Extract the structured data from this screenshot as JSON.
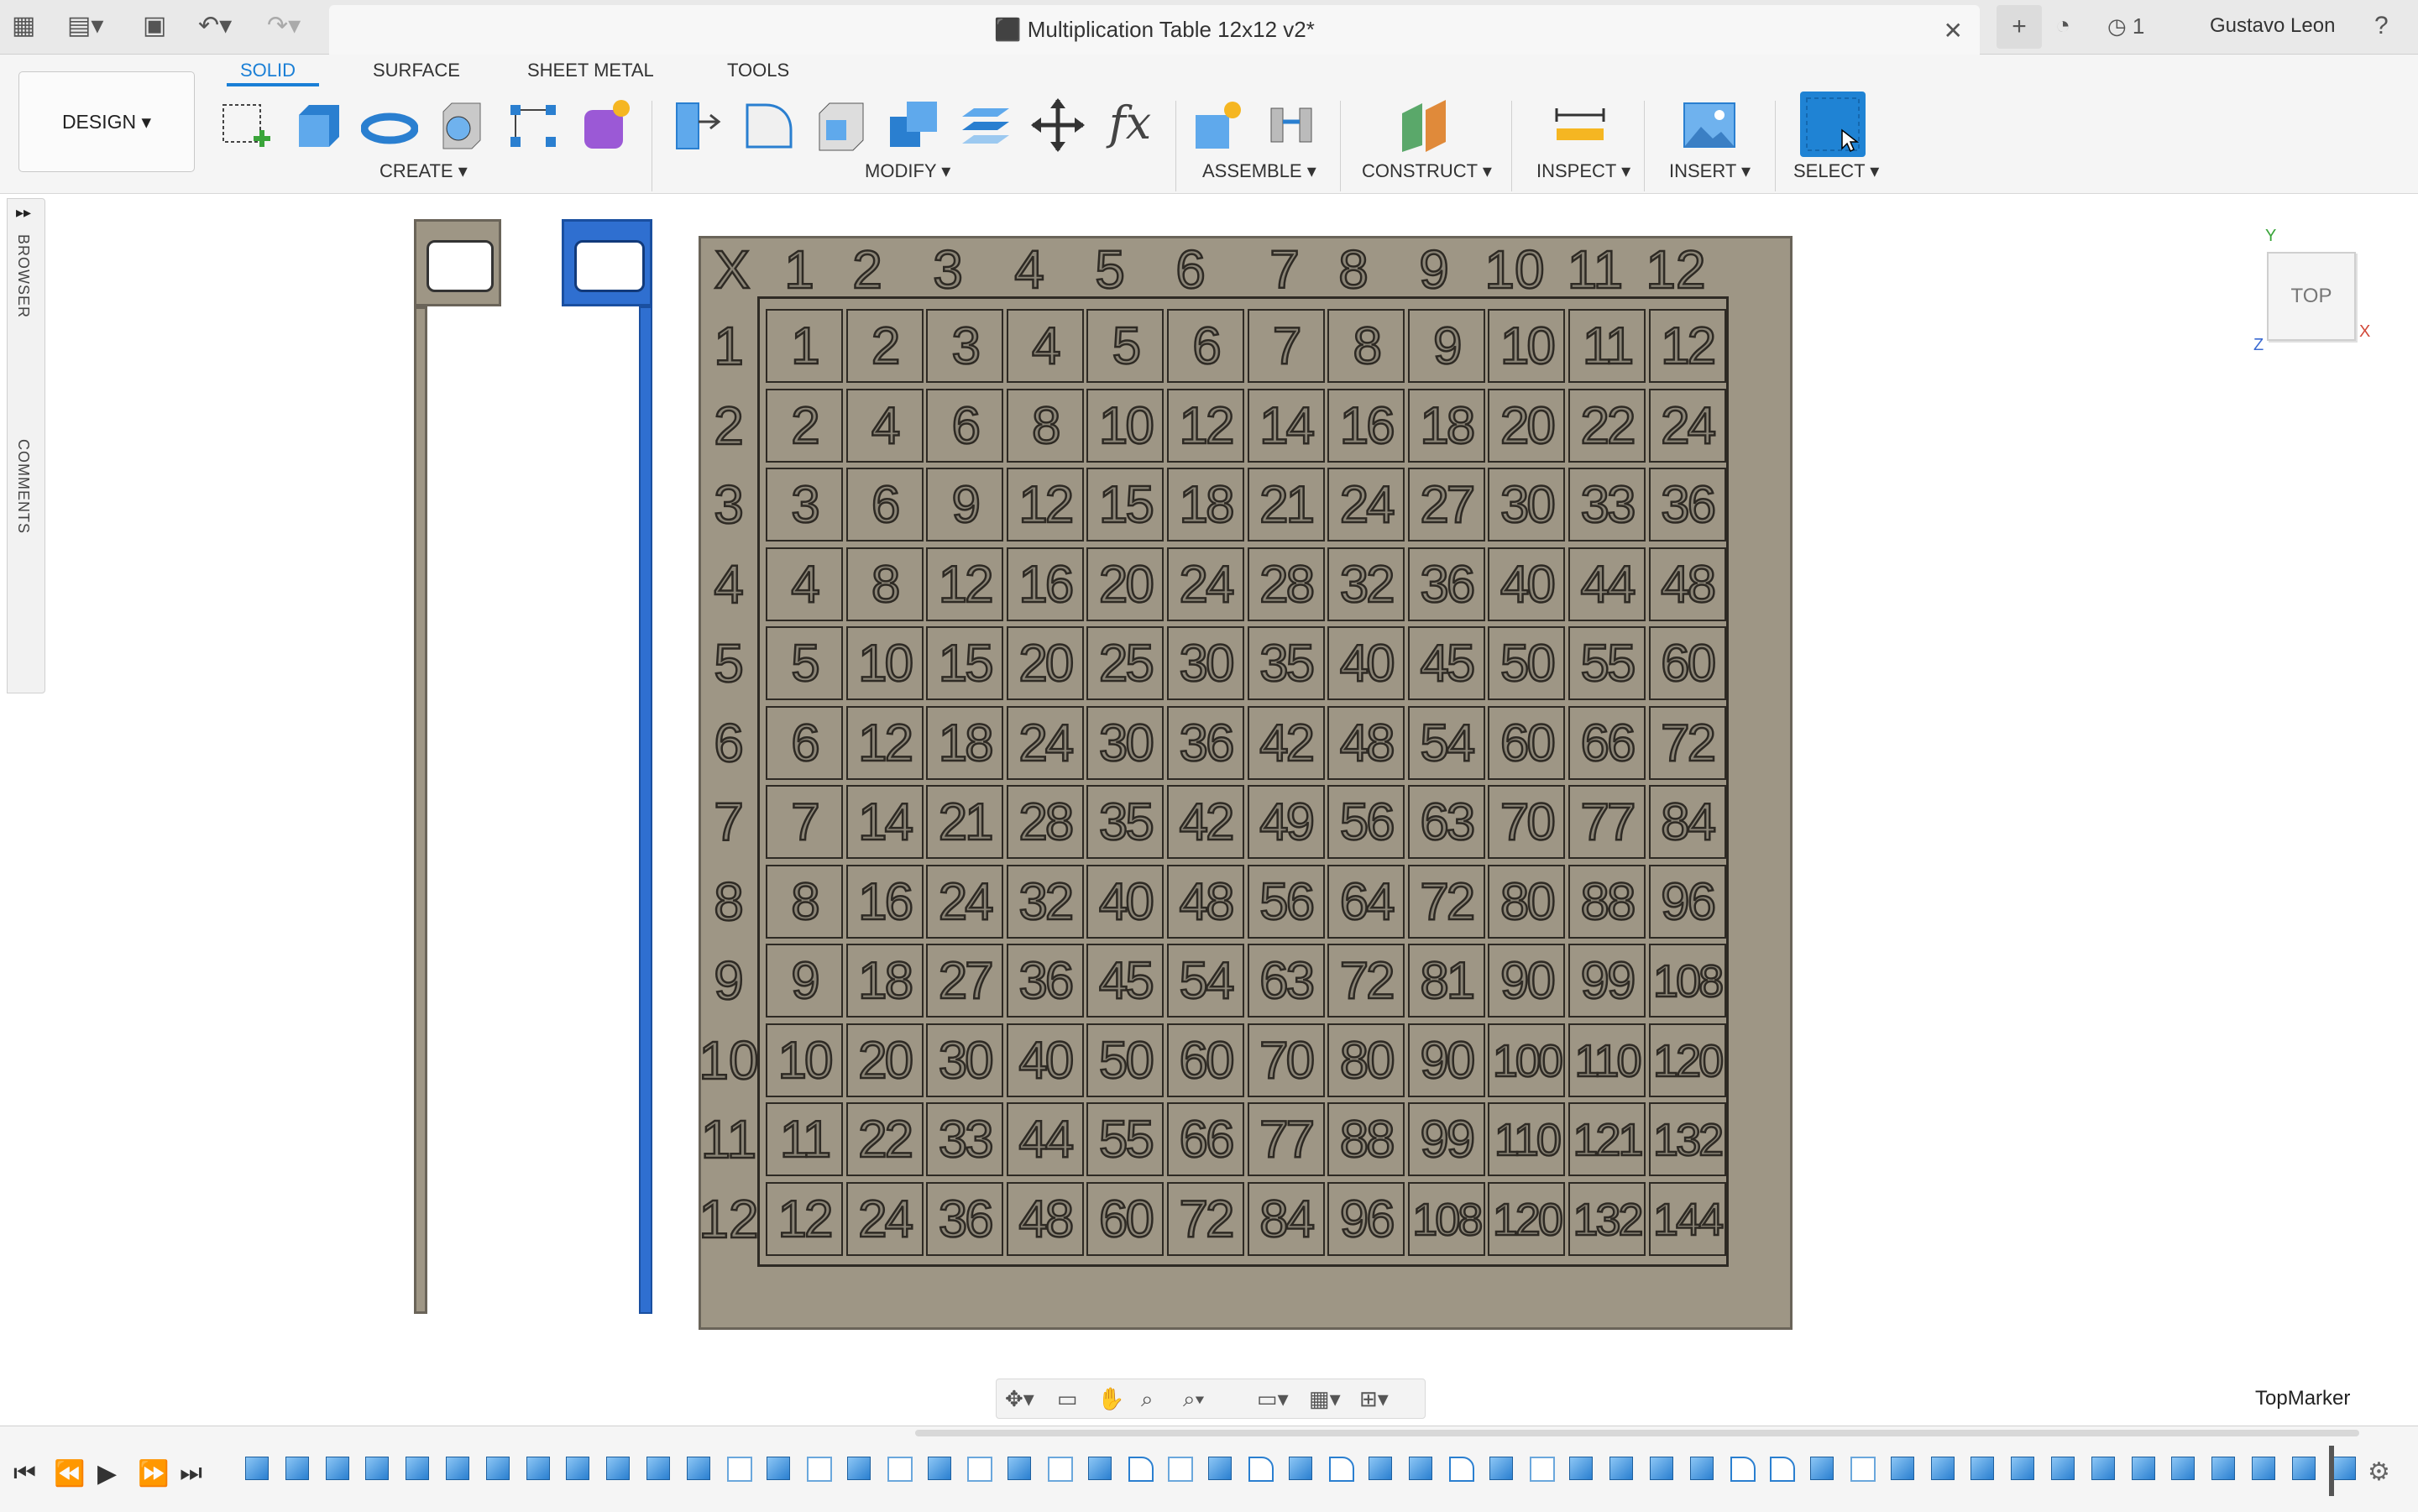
{
  "titlebar": {
    "doc_title": "Multiplication Table 12x12 v2*",
    "job_count": "1",
    "user_name": "Gustavo Leon"
  },
  "ribbon": {
    "tabs": [
      "SOLID",
      "SURFACE",
      "SHEET METAL",
      "TOOLS"
    ],
    "active_tab": "SOLID",
    "workspace": "DESIGN",
    "groups": [
      "CREATE",
      "MODIFY",
      "ASSEMBLE",
      "CONSTRUCT",
      "INSPECT",
      "INSERT",
      "SELECT"
    ]
  },
  "side_panel": {
    "browser": "BROWSER",
    "comments": "COMMENTS"
  },
  "viewport": {
    "table_header": [
      "X",
      "1",
      "2",
      "3",
      "4",
      "5",
      "6",
      "7",
      "8",
      "9",
      "10",
      "11",
      "12"
    ],
    "row_headers": [
      "1",
      "2",
      "3",
      "4",
      "5",
      "6",
      "7",
      "8",
      "9",
      "10",
      "11",
      "12"
    ],
    "cells": [
      [
        "1",
        "2",
        "3",
        "4",
        "5",
        "6",
        "7",
        "8",
        "9",
        "10",
        "11",
        "12"
      ],
      [
        "2",
        "4",
        "6",
        "8",
        "10",
        "12",
        "14",
        "16",
        "18",
        "20",
        "22",
        "24"
      ],
      [
        "3",
        "6",
        "9",
        "12",
        "15",
        "18",
        "21",
        "24",
        "27",
        "30",
        "33",
        "36"
      ],
      [
        "4",
        "8",
        "12",
        "16",
        "20",
        "24",
        "28",
        "32",
        "36",
        "40",
        "44",
        "48"
      ],
      [
        "5",
        "10",
        "15",
        "20",
        "25",
        "30",
        "35",
        "40",
        "45",
        "50",
        "55",
        "60"
      ],
      [
        "6",
        "12",
        "18",
        "24",
        "30",
        "36",
        "42",
        "48",
        "54",
        "60",
        "66",
        "72"
      ],
      [
        "7",
        "14",
        "21",
        "28",
        "35",
        "42",
        "49",
        "56",
        "63",
        "70",
        "77",
        "84"
      ],
      [
        "8",
        "16",
        "24",
        "32",
        "40",
        "48",
        "56",
        "64",
        "72",
        "80",
        "88",
        "96"
      ],
      [
        "9",
        "18",
        "27",
        "36",
        "45",
        "54",
        "63",
        "72",
        "81",
        "90",
        "99",
        "108"
      ],
      [
        "10",
        "20",
        "30",
        "40",
        "50",
        "60",
        "70",
        "80",
        "90",
        "100",
        "110",
        "120"
      ],
      [
        "11",
        "22",
        "33",
        "44",
        "55",
        "66",
        "77",
        "88",
        "99",
        "110",
        "121",
        "132"
      ],
      [
        "12",
        "24",
        "36",
        "48",
        "60",
        "72",
        "84",
        "96",
        "108",
        "120",
        "132",
        "144"
      ]
    ],
    "plate_color": "#9e9685",
    "selected_color": "#2f6fd0"
  },
  "viewcube": {
    "face": "TOP",
    "axis_x": "X",
    "axis_y": "Y",
    "axis_z": "Z"
  },
  "named_view": "TopMarker",
  "timeline": {
    "items": [
      "solid",
      "solid",
      "solid",
      "solid",
      "solid",
      "solid",
      "solid",
      "solid",
      "solid",
      "solid",
      "solid",
      "solid",
      "sketch",
      "solid",
      "sketch",
      "solid",
      "sketch",
      "solid",
      "sketch",
      "solid",
      "sketch",
      "solid",
      "fillet",
      "sketch",
      "solid",
      "fillet",
      "solid",
      "fillet",
      "solid",
      "solid",
      "fillet",
      "solid",
      "sketch",
      "solid",
      "solid",
      "solid",
      "solid",
      "fillet",
      "fillet",
      "solid",
      "sketch",
      "solid",
      "solid",
      "solid",
      "solid",
      "solid",
      "solid",
      "solid",
      "solid",
      "solid",
      "solid",
      "solid",
      "solid"
    ]
  }
}
